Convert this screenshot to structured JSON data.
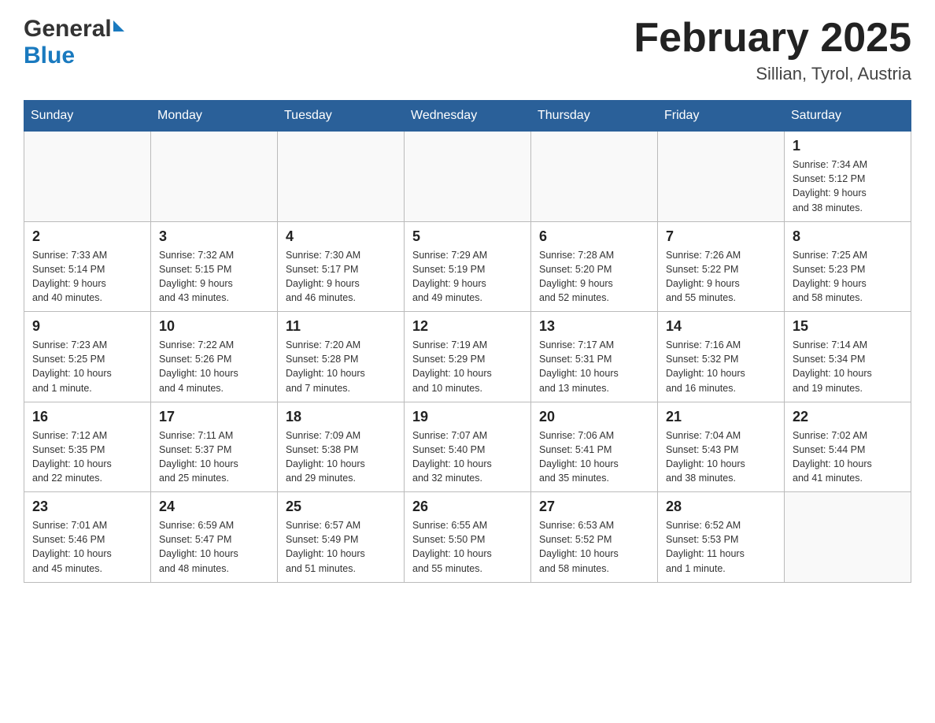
{
  "header": {
    "logo": {
      "name_part1": "General",
      "arrow": "▲",
      "name_part2": "Blue"
    },
    "title": "February 2025",
    "location": "Sillian, Tyrol, Austria"
  },
  "weekdays": [
    "Sunday",
    "Monday",
    "Tuesday",
    "Wednesday",
    "Thursday",
    "Friday",
    "Saturday"
  ],
  "weeks": [
    {
      "days": [
        {
          "number": "",
          "info": ""
        },
        {
          "number": "",
          "info": ""
        },
        {
          "number": "",
          "info": ""
        },
        {
          "number": "",
          "info": ""
        },
        {
          "number": "",
          "info": ""
        },
        {
          "number": "",
          "info": ""
        },
        {
          "number": "1",
          "info": "Sunrise: 7:34 AM\nSunset: 5:12 PM\nDaylight: 9 hours\nand 38 minutes."
        }
      ]
    },
    {
      "days": [
        {
          "number": "2",
          "info": "Sunrise: 7:33 AM\nSunset: 5:14 PM\nDaylight: 9 hours\nand 40 minutes."
        },
        {
          "number": "3",
          "info": "Sunrise: 7:32 AM\nSunset: 5:15 PM\nDaylight: 9 hours\nand 43 minutes."
        },
        {
          "number": "4",
          "info": "Sunrise: 7:30 AM\nSunset: 5:17 PM\nDaylight: 9 hours\nand 46 minutes."
        },
        {
          "number": "5",
          "info": "Sunrise: 7:29 AM\nSunset: 5:19 PM\nDaylight: 9 hours\nand 49 minutes."
        },
        {
          "number": "6",
          "info": "Sunrise: 7:28 AM\nSunset: 5:20 PM\nDaylight: 9 hours\nand 52 minutes."
        },
        {
          "number": "7",
          "info": "Sunrise: 7:26 AM\nSunset: 5:22 PM\nDaylight: 9 hours\nand 55 minutes."
        },
        {
          "number": "8",
          "info": "Sunrise: 7:25 AM\nSunset: 5:23 PM\nDaylight: 9 hours\nand 58 minutes."
        }
      ]
    },
    {
      "days": [
        {
          "number": "9",
          "info": "Sunrise: 7:23 AM\nSunset: 5:25 PM\nDaylight: 10 hours\nand 1 minute."
        },
        {
          "number": "10",
          "info": "Sunrise: 7:22 AM\nSunset: 5:26 PM\nDaylight: 10 hours\nand 4 minutes."
        },
        {
          "number": "11",
          "info": "Sunrise: 7:20 AM\nSunset: 5:28 PM\nDaylight: 10 hours\nand 7 minutes."
        },
        {
          "number": "12",
          "info": "Sunrise: 7:19 AM\nSunset: 5:29 PM\nDaylight: 10 hours\nand 10 minutes."
        },
        {
          "number": "13",
          "info": "Sunrise: 7:17 AM\nSunset: 5:31 PM\nDaylight: 10 hours\nand 13 minutes."
        },
        {
          "number": "14",
          "info": "Sunrise: 7:16 AM\nSunset: 5:32 PM\nDaylight: 10 hours\nand 16 minutes."
        },
        {
          "number": "15",
          "info": "Sunrise: 7:14 AM\nSunset: 5:34 PM\nDaylight: 10 hours\nand 19 minutes."
        }
      ]
    },
    {
      "days": [
        {
          "number": "16",
          "info": "Sunrise: 7:12 AM\nSunset: 5:35 PM\nDaylight: 10 hours\nand 22 minutes."
        },
        {
          "number": "17",
          "info": "Sunrise: 7:11 AM\nSunset: 5:37 PM\nDaylight: 10 hours\nand 25 minutes."
        },
        {
          "number": "18",
          "info": "Sunrise: 7:09 AM\nSunset: 5:38 PM\nDaylight: 10 hours\nand 29 minutes."
        },
        {
          "number": "19",
          "info": "Sunrise: 7:07 AM\nSunset: 5:40 PM\nDaylight: 10 hours\nand 32 minutes."
        },
        {
          "number": "20",
          "info": "Sunrise: 7:06 AM\nSunset: 5:41 PM\nDaylight: 10 hours\nand 35 minutes."
        },
        {
          "number": "21",
          "info": "Sunrise: 7:04 AM\nSunset: 5:43 PM\nDaylight: 10 hours\nand 38 minutes."
        },
        {
          "number": "22",
          "info": "Sunrise: 7:02 AM\nSunset: 5:44 PM\nDaylight: 10 hours\nand 41 minutes."
        }
      ]
    },
    {
      "days": [
        {
          "number": "23",
          "info": "Sunrise: 7:01 AM\nSunset: 5:46 PM\nDaylight: 10 hours\nand 45 minutes."
        },
        {
          "number": "24",
          "info": "Sunrise: 6:59 AM\nSunset: 5:47 PM\nDaylight: 10 hours\nand 48 minutes."
        },
        {
          "number": "25",
          "info": "Sunrise: 6:57 AM\nSunset: 5:49 PM\nDaylight: 10 hours\nand 51 minutes."
        },
        {
          "number": "26",
          "info": "Sunrise: 6:55 AM\nSunset: 5:50 PM\nDaylight: 10 hours\nand 55 minutes."
        },
        {
          "number": "27",
          "info": "Sunrise: 6:53 AM\nSunset: 5:52 PM\nDaylight: 10 hours\nand 58 minutes."
        },
        {
          "number": "28",
          "info": "Sunrise: 6:52 AM\nSunset: 5:53 PM\nDaylight: 11 hours\nand 1 minute."
        },
        {
          "number": "",
          "info": ""
        }
      ]
    }
  ],
  "colors": {
    "header_bg": "#2a6099",
    "header_text": "#ffffff",
    "border": "#bbb"
  }
}
